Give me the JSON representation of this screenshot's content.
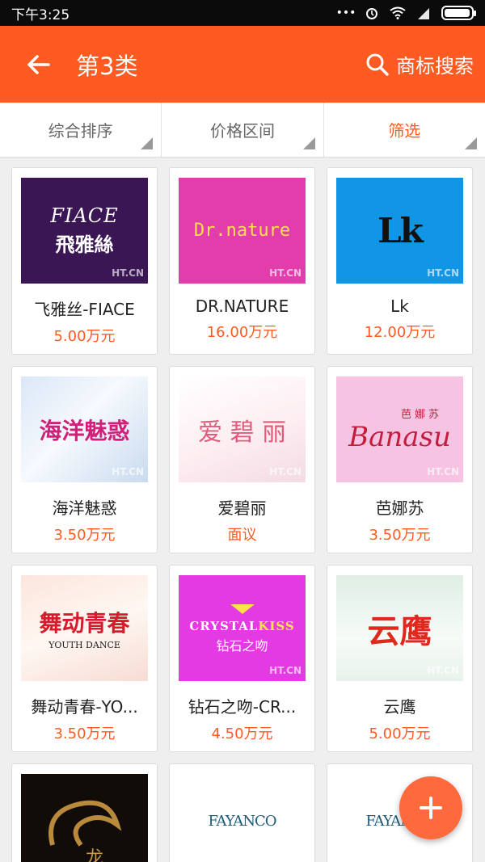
{
  "status_bar": {
    "time": "下午3:25"
  },
  "header": {
    "title": "第3类",
    "search_label": "商标搜索"
  },
  "filters": [
    {
      "label": "综合排序",
      "active": false
    },
    {
      "label": "价格区间",
      "active": false
    },
    {
      "label": "筛选",
      "active": true
    }
  ],
  "watermark": "HT.CN",
  "items": [
    {
      "name": "飞雅丝-FIACE",
      "price": "5.00万元",
      "logo_lines": [
        "FIACE",
        "飛雅絲"
      ]
    },
    {
      "name": "DR.NATURE",
      "price": "16.00万元",
      "logo_lines": [
        "Dr.nature"
      ]
    },
    {
      "name": "Lk",
      "price": "12.00万元",
      "logo_lines": [
        "Lk"
      ]
    },
    {
      "name": "海洋魅惑",
      "price": "3.50万元",
      "logo_lines": [
        "海洋魅惑"
      ]
    },
    {
      "name": "爱碧丽",
      "price": "面议",
      "logo_lines": [
        "爱 碧 丽"
      ]
    },
    {
      "name": "芭娜苏",
      "price": "3.50万元",
      "logo_lines": [
        "芭 娜 苏",
        "Banasu"
      ]
    },
    {
      "name": "舞动青春-YO...",
      "price": "3.50万元",
      "logo_lines": [
        "舞动青春",
        "YOUTH DANCE"
      ]
    },
    {
      "name": "钻石之吻-CR...",
      "price": "4.50万元",
      "logo_lines": [
        "CRYSTAL",
        "KISS",
        "钻石之吻"
      ]
    },
    {
      "name": "云鹰",
      "price": "5.00万元",
      "logo_lines": [
        "云鹰"
      ]
    }
  ],
  "partial_items": [
    {
      "logo_lines": [
        "龙"
      ]
    },
    {
      "logo_lines": [
        "FAYANCO"
      ]
    },
    {
      "logo_lines": [
        "FAYANCO"
      ]
    }
  ],
  "fab": {
    "icon": "plus-icon"
  },
  "colors": {
    "accent": "#fe5a22",
    "price": "#fe5a22"
  }
}
